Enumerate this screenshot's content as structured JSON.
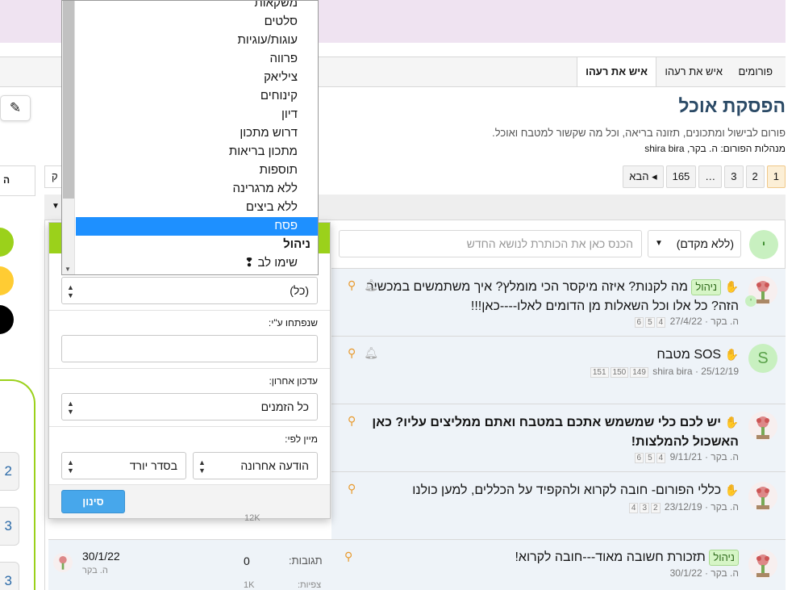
{
  "breadcrumb": {
    "items": [
      "פורומים",
      "איש את רעהו"
    ],
    "active": "איש את רעהו"
  },
  "forum": {
    "title": "הפסקת אוכל",
    "description": "פורום לבישול ומתכונים, תזונה בריאה, וכל מה שקשור למטבח ואוכל.",
    "moderators_label": "מנהלות הפורום:",
    "moderators": "ה. בקר, shira bira"
  },
  "pagination": {
    "pages": [
      "1",
      "2",
      "3",
      "…",
      "165"
    ],
    "next": "הבא ◂"
  },
  "new_thread": {
    "avatar_letter": "י",
    "prefix": "(ללא מקדם)",
    "placeholder": "הכנס כאן את הכותרת לנושא החדש"
  },
  "threads": [
    {
      "label": "ניהול",
      "title": "מה לקנות? איזה מיקסר הכי מומלץ? איך משתמשים במכשיר הזה? כל אלו וכל השאלות מן הדומים לאלו----כאן!!!",
      "author": "ה. בקר",
      "date": "27/4/22",
      "pages": [
        "4",
        "5",
        "6"
      ]
    },
    {
      "label": "",
      "title": "SOS מטבח",
      "author": "shira bira",
      "date": "25/12/19",
      "pages": [
        "149",
        "150",
        "151"
      ],
      "avatar_letter": "S"
    },
    {
      "label": "",
      "title": "יש לכם כלי שמשמש אתכם במטבח ואתם ממליצים עליו? כאן האשכול להמלצות!",
      "author": "ה. בקר",
      "date": "9/11/21",
      "pages": [
        "4",
        "5",
        "6"
      ]
    },
    {
      "label": "",
      "title": "כללי הפורום- חובה לקרוא ולהקפיד על הכללים, למען כולנו",
      "author": "ה. בקר",
      "date": "23/12/19",
      "pages": [
        "2",
        "3",
        "4"
      ]
    },
    {
      "label": "ניהול",
      "title": "תזכורת חשובה מאוד---חובה לקרוא!",
      "author": "ה. בקר",
      "date": "30/1/22",
      "pages": []
    }
  ],
  "last_row_stats": {
    "replies_label": "תגובות:",
    "replies": "0",
    "views_label": "צפיות:",
    "views": "1K",
    "last_date": "30/1/22",
    "last_author": "ה. בקר",
    "hidden_views": "12K"
  },
  "filter": {
    "prefix_value": "(כל)",
    "started_by_label": "שנפתחו ע\"י:",
    "last_update_label": "עדכון אחרון:",
    "last_update_value": "כל הזמנים",
    "sort_label": "מיין לפי:",
    "sort_field": "הודעה אחרונה",
    "sort_dir": "בסדר יורד",
    "button": "סינון"
  },
  "prefix_list": {
    "items": [
      "משקאות",
      "סלטים",
      "עוגות/עוגיות",
      "פרווה",
      "ציליאק",
      "קינוחים",
      "דיון",
      "דרוש מתכון",
      "מתכון בריאות",
      "תוספות",
      "ללא מרגרינה",
      "ללא ביצים",
      "פסח"
    ],
    "selected": "פסח",
    "group": "ניהול",
    "after_group": "שימו לב ❢"
  },
  "left_column": {
    "numbers": [
      "2",
      "3",
      "3"
    ],
    "partial_button": "ק"
  },
  "colors": {
    "accent_green": "#9bd11b",
    "yellow": "#ffcc33",
    "black": "#000000",
    "title_blue": "#2b4a66",
    "selected_blue": "#1e90ff",
    "filter_button": "#47a7eb"
  }
}
